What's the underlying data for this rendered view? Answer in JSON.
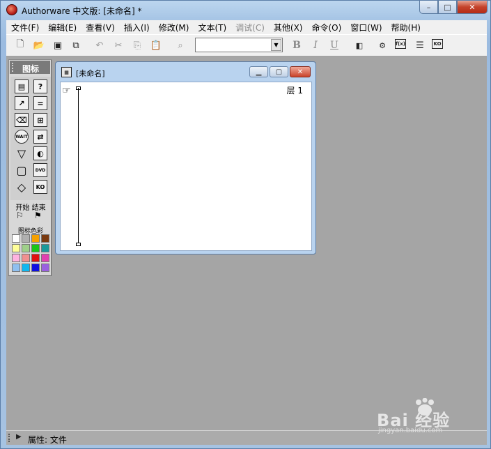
{
  "window": {
    "title": "Authorware 中文版: [未命名] *",
    "controls": {
      "minimize": "–",
      "maximize": "□",
      "close": "✕"
    }
  },
  "menubar": {
    "items": [
      {
        "label": "文件(F)",
        "enabled": true
      },
      {
        "label": "编辑(E)",
        "enabled": true
      },
      {
        "label": "查看(V)",
        "enabled": true
      },
      {
        "label": "插入(I)",
        "enabled": true
      },
      {
        "label": "修改(M)",
        "enabled": true
      },
      {
        "label": "文本(T)",
        "enabled": true
      },
      {
        "label": "调试(C)",
        "enabled": false
      },
      {
        "label": "其他(X)",
        "enabled": true
      },
      {
        "label": "命令(O)",
        "enabled": true
      },
      {
        "label": "窗口(W)",
        "enabled": true
      },
      {
        "label": "帮助(H)",
        "enabled": true
      }
    ]
  },
  "toolbar": {
    "font_combo_value": "",
    "bold_label": "B",
    "italic_label": "I",
    "underline_label": "U",
    "functions_label": "f(x)",
    "knowledge_label": "KO"
  },
  "icon_palette": {
    "title": "图标",
    "start_label": "开始",
    "end_label": "结束",
    "colors_label": "图标色彩",
    "wait_label": "WAIT",
    "dvd_label": "DVD",
    "ko_label": "KO",
    "swatch_colors": [
      "#ffffff",
      "#b0b0b0",
      "#f5a000",
      "#7a3a10",
      "#ffff99",
      "#9fd08a",
      "#19c519",
      "#1a9a9a",
      "#ffb3e0",
      "#f09090",
      "#e01010",
      "#e040b0",
      "#8fc0f0",
      "#10b8f0",
      "#1010e0",
      "#9a60e0"
    ]
  },
  "design_window": {
    "title": "[未命名]",
    "level_label": "层 1"
  },
  "statusbar": {
    "text": "属性: 文件"
  },
  "watermark": {
    "text": "Bai 经验",
    "url": "jingyan.baidu.com"
  }
}
